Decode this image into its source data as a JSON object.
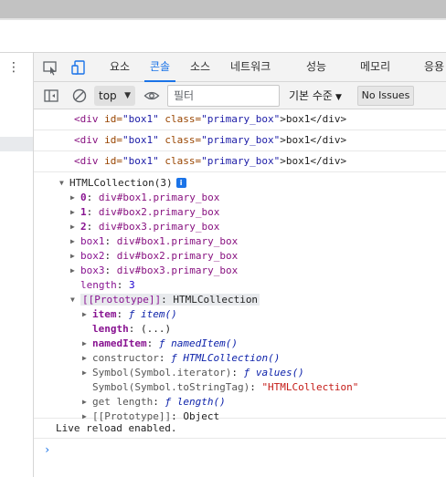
{
  "devtools": {
    "tabs": [
      {
        "label": "요소"
      },
      {
        "label": "콘솔",
        "active": true
      },
      {
        "label": "소스"
      },
      {
        "label": "네트워크"
      },
      {
        "label": "성능"
      },
      {
        "label": "메모리"
      },
      {
        "label": "응용"
      }
    ],
    "toolbar": {
      "context": "top",
      "filter_placeholder": "필터",
      "levels": "기본 수준",
      "issues": "No Issues"
    }
  },
  "console": {
    "messages": [
      {
        "open": "<div ",
        "id_attr": "id=",
        "id_val": "\"box1\"",
        "class_attr": "class=",
        "class_val": "\"primary_box\"",
        "text": ">box1</div>"
      },
      {
        "open": "<div ",
        "id_attr": "id=",
        "id_val": "\"box1\"",
        "class_attr": "class=",
        "class_val": "\"primary_box\"",
        "text": ">box1</div>"
      },
      {
        "open": "<div ",
        "id_attr": "id=",
        "id_val": "\"box1\"",
        "class_attr": "class=",
        "class_val": "\"primary_box\"",
        "text": ">box1</div>"
      }
    ],
    "collection": {
      "header": "HTMLCollection(3)",
      "info": "i",
      "items": [
        {
          "key": "0",
          "value": "div#box1.primary_box"
        },
        {
          "key": "1",
          "value": "div#box2.primary_box"
        },
        {
          "key": "2",
          "value": "div#box3.primary_box"
        },
        {
          "key": "box1",
          "value": "div#box1.primary_box"
        },
        {
          "key": "box2",
          "value": "div#box2.primary_box"
        },
        {
          "key": "box3",
          "value": "div#box3.primary_box"
        }
      ],
      "length_key": "length",
      "length_value": "3",
      "prototype_key": "[[Prototype]]",
      "prototype_value": "HTMLCollection",
      "proto_members": {
        "item_key": "item",
        "item_fn": "item()",
        "length_key": "length",
        "length_val": "(...)",
        "nameditem_key": "namedItem",
        "nameditem_fn": "namedItem()",
        "constructor_key": "constructor",
        "constructor_fn": "HTMLCollection()",
        "iterator_key": "Symbol(Symbol.iterator)",
        "iterator_fn": "values()",
        "tostringtag_key": "Symbol(Symbol.toStringTag)",
        "tostringtag_val": "\"HTMLCollection\"",
        "getlength_key": "get length",
        "getlength_fn": "length()",
        "proto2_key": "[[Prototype]]",
        "proto2_val": "Object"
      },
      "fn_symbol": "ƒ"
    },
    "live_reload": "Live reload enabled.",
    "prompt": "›"
  },
  "colors": {
    "accent": "#1a73e8",
    "tag": "#881280",
    "attr_name": "#994500",
    "attr_value": "#1a1aa6",
    "string": "#c41a16"
  }
}
